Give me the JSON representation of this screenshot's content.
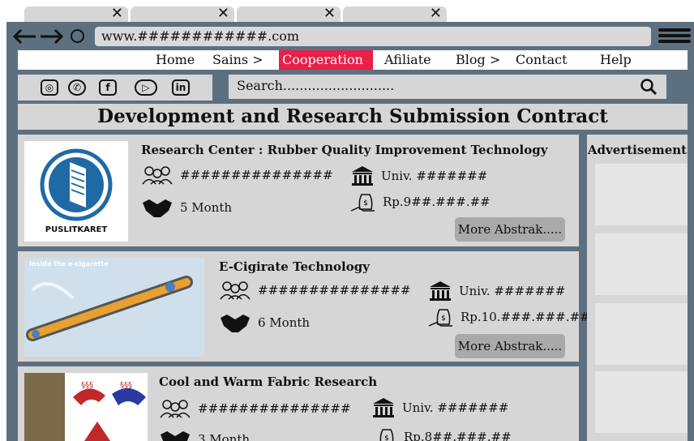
{
  "browser": {
    "url": "www.############.com",
    "tab_close": "✕"
  },
  "nav": {
    "items": [
      "Home",
      "Sains >",
      "Cooperation",
      "Afiliate",
      "Blog >",
      "Contact",
      "Help"
    ]
  },
  "search": {
    "placeholder": "Search..........................."
  },
  "page": {
    "title": "Development and Research Submission Contract"
  },
  "cards": [
    {
      "title": "Research Center : Rubber Quality Improvement Technology",
      "researchers": "###############",
      "institution": "Univ. #######",
      "duration": "5 Month",
      "budget": "Rp.9##.###.##",
      "more": "More Abstrak.....",
      "logo_text": "PUSLITKARET"
    },
    {
      "title": "E-Cigirate Technology",
      "researchers": "###############",
      "institution": "Univ. #######",
      "duration": "6 Month",
      "budget": "Rp.10.###.###.##",
      "more": "More Abstrak.....",
      "image_caption": "Inside the e-cigarette"
    },
    {
      "title": "Cool and Warm Fabric Research",
      "researchers": "###############",
      "institution": "Univ. #######",
      "duration": "3 Month",
      "budget": "Rp.8##.###.##"
    }
  ],
  "sidebar": {
    "title": "Advertisement"
  },
  "colors": {
    "frame": "#5d7080",
    "panel": "#d6d6d6",
    "active_nav": "#e8204a",
    "button": "#a9a9a9"
  }
}
